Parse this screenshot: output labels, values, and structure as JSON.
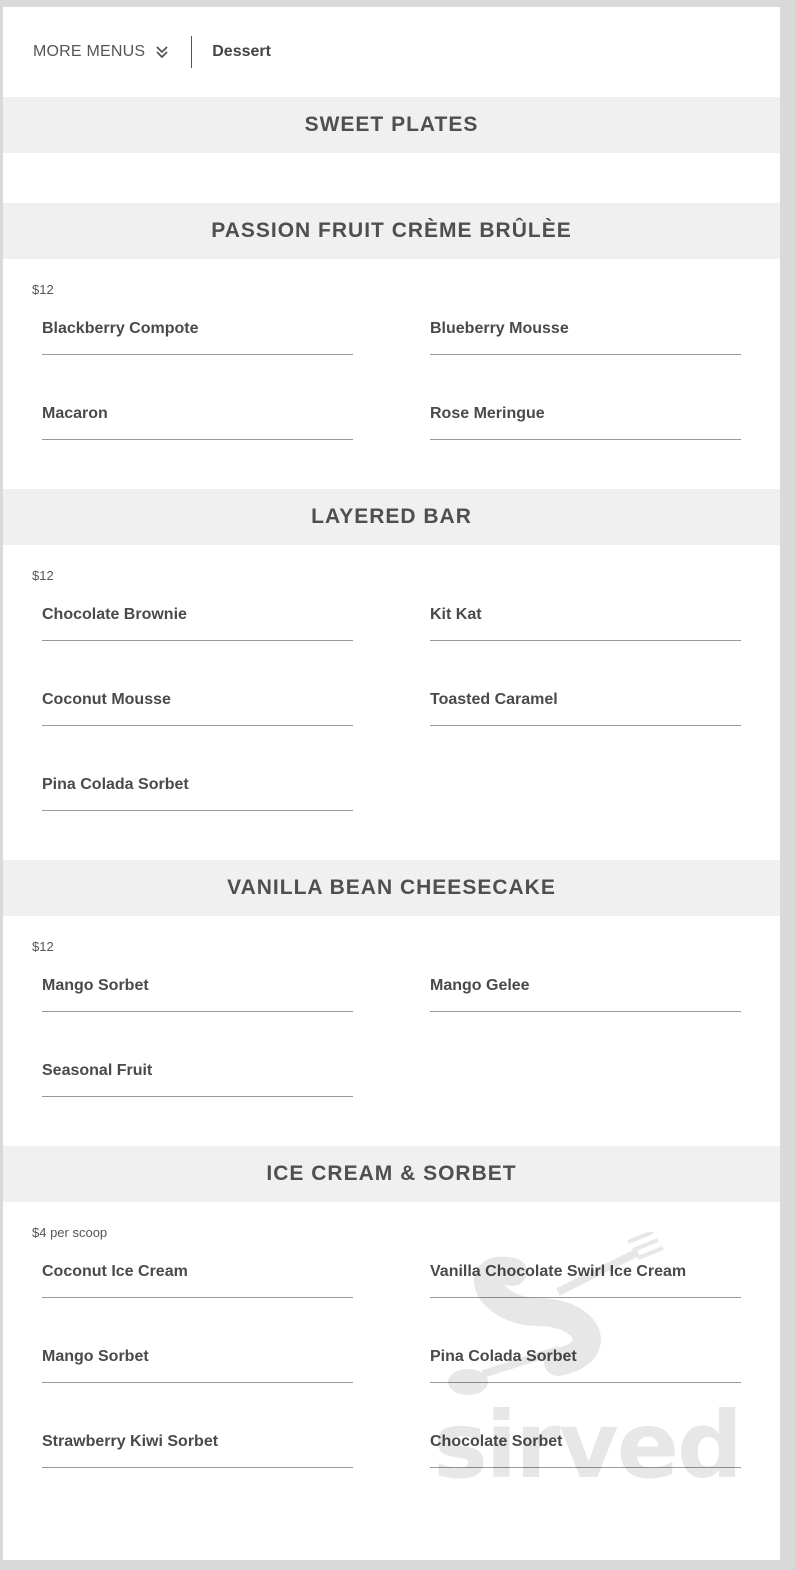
{
  "topbar": {
    "more_menus_label": "MORE MENUS",
    "current_menu": "Dessert"
  },
  "sections": {
    "sweet_plates": {
      "title": "SWEET PLATES"
    },
    "creme_brulee": {
      "title": "PASSION FRUIT CRÈME BRÛLÈE",
      "price": "$12",
      "items": [
        "Blackberry Compote",
        "Blueberry Mousse",
        "Macaron",
        "Rose Meringue"
      ]
    },
    "layered_bar": {
      "title": "LAYERED BAR",
      "price": "$12",
      "items": [
        "Chocolate Brownie",
        "Kit Kat",
        "Coconut Mousse",
        "Toasted Caramel",
        "Pina Colada Sorbet"
      ]
    },
    "cheesecake": {
      "title": "VANILLA BEAN CHEESECAKE",
      "price": "$12",
      "items": [
        "Mango Sorbet",
        "Mango Gelee",
        "Seasonal Fruit"
      ]
    },
    "ice_cream": {
      "title": "ICE CREAM & SORBET",
      "price": "$4 per scoop",
      "items": [
        "Coconut Ice Cream",
        "Vanilla Chocolate Swirl Ice Cream",
        "Mango Sorbet",
        "Pina Colada Sorbet",
        "Strawberry Kiwi Sorbet",
        "Chocolate Sorbet"
      ]
    }
  },
  "watermark": {
    "text": "sirved"
  },
  "colors": {
    "page_background": "#d9d9d9",
    "card_background": "#ffffff",
    "section_header_background": "#f0f0f0",
    "text": "#4a4a4a",
    "rule": "#9a9a9a"
  },
  "icons": {
    "more_menus": "chevron-double-down-icon",
    "watermark_logo": "fork-spoon-logo"
  }
}
